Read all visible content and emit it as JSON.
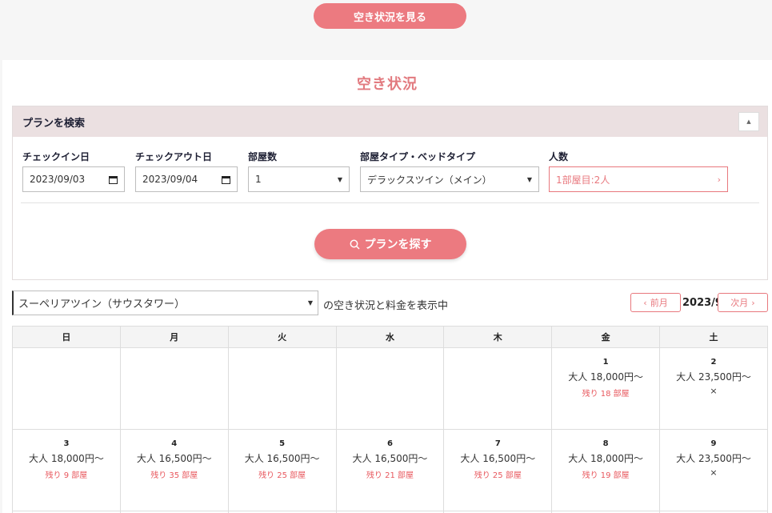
{
  "top_button": "空き状況を見る",
  "section_title": "空き状況",
  "search": {
    "header": "プランを検索",
    "collapse_icon": "▲",
    "checkin_label": "チェックイン日",
    "checkin_value": "2023/09/03",
    "checkout_label": "チェックアウト日",
    "checkout_value": "2023/09/04",
    "rooms_label": "部屋数",
    "rooms_value": "1",
    "roomtype_label": "部屋タイプ・ベッドタイプ",
    "roomtype_value": "デラックスツイン（メイン）",
    "people_label": "人数",
    "people_value": "1部屋目:2人",
    "search_button": "プランを探す"
  },
  "room_filter": {
    "selected": "スーペリアツイン（サウスタワー）",
    "caption": "の空き状況と料金を表示中",
    "prev": "前月",
    "month": "2023/9",
    "next": "次月"
  },
  "calendar": {
    "weekdays": [
      "日",
      "月",
      "火",
      "水",
      "木",
      "金",
      "土"
    ],
    "week1": [
      {
        "day": "",
        "price": "",
        "remain": "",
        "mark": ""
      },
      {
        "day": "",
        "price": "",
        "remain": "",
        "mark": ""
      },
      {
        "day": "",
        "price": "",
        "remain": "",
        "mark": ""
      },
      {
        "day": "",
        "price": "",
        "remain": "",
        "mark": ""
      },
      {
        "day": "",
        "price": "",
        "remain": "",
        "mark": ""
      },
      {
        "day": "1",
        "price": "大人 18,000円〜",
        "remain": "残り 18 部屋",
        "mark": ""
      },
      {
        "day": "2",
        "price": "大人 23,500円〜",
        "remain": "",
        "mark": "×"
      }
    ],
    "week2": [
      {
        "day": "3",
        "price": "大人 18,000円〜",
        "remain": "残り 9 部屋",
        "mark": ""
      },
      {
        "day": "4",
        "price": "大人 16,500円〜",
        "remain": "残り 35 部屋",
        "mark": ""
      },
      {
        "day": "5",
        "price": "大人 16,500円〜",
        "remain": "残り 25 部屋",
        "mark": ""
      },
      {
        "day": "6",
        "price": "大人 16,500円〜",
        "remain": "残り 21 部屋",
        "mark": ""
      },
      {
        "day": "7",
        "price": "大人 16,500円〜",
        "remain": "残り 25 部屋",
        "mark": ""
      },
      {
        "day": "8",
        "price": "大人 18,000円〜",
        "remain": "残り 19 部屋",
        "mark": ""
      },
      {
        "day": "9",
        "price": "大人 23,500円〜",
        "remain": "",
        "mark": "×"
      }
    ]
  }
}
